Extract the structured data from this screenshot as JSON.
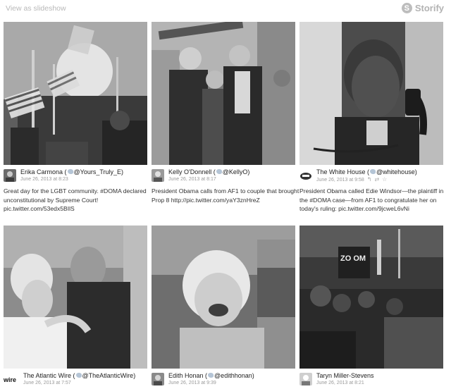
{
  "header": {
    "slideshow_label": "View as slideshow",
    "brand_name": "Storify",
    "brand_mark": "S"
  },
  "cards": [
    {
      "author": "Erika Carmona",
      "handle": "@Yours_Truly_E",
      "date": "June 26, 2013 at 8:23",
      "text": "Great day for the LGBT community. #DOMA declared unconstitutional by Supreme Court! pic.twitter.com/53edx5BIlS"
    },
    {
      "author": "Kelly O'Donnell",
      "handle": "@KellyO",
      "date": "June 26, 2013 at 8:17",
      "text": "President Obama calls from AF1 to couple that brought Prop 8 http://pic.twitter.com/yaY3znHreZ"
    },
    {
      "author": "The White House",
      "handle": "@whitehouse",
      "date": "June 26, 2013 at 9:58",
      "text": "President Obama called Edie Windsor—the plaintiff in the #DOMA case—from AF1 to congratulate her on today's ruling: pic.twitter.com/9jcweL6vNi"
    },
    {
      "author": "The Atlantic Wire",
      "handle": "@TheAtlanticWire",
      "date": "June 26, 2013 at 7:57",
      "text": ""
    },
    {
      "author": "Edith Honan",
      "handle": "@edithhonan",
      "date": "June 26, 2013 at 9:39",
      "text": ""
    },
    {
      "author": "Taryn Miller-Stevens",
      "handle": "",
      "date": "June 26, 2013 at 8:21",
      "text": ""
    }
  ],
  "photo_sign_text": "ZO OM",
  "avatar_text_wire": "wire",
  "colors": {
    "accent_gray": "#b8b8b8",
    "text_dark": "#222222",
    "date_gray": "#999999"
  }
}
